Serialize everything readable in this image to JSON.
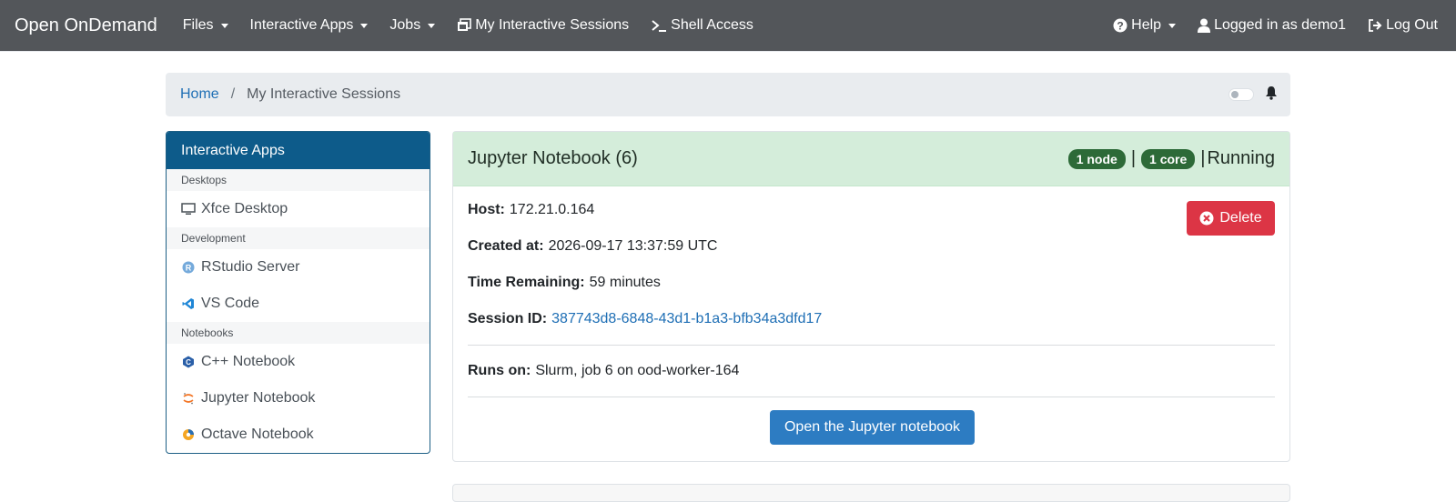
{
  "navbar": {
    "brand": "Open OnDemand",
    "items": [
      {
        "label": "Files"
      },
      {
        "label": "Interactive Apps"
      },
      {
        "label": "Jobs"
      },
      {
        "label": "My Interactive Sessions"
      },
      {
        "label": "Shell Access"
      }
    ],
    "help_label": "Help",
    "user_label": "Logged in as demo1",
    "logout_label": "Log Out"
  },
  "breadcrumb": {
    "home": "Home",
    "separator": "/",
    "current": "My Interactive Sessions"
  },
  "sidebar": {
    "title": "Interactive Apps",
    "categories": [
      {
        "name": "Desktops",
        "items": [
          {
            "label": "Xfce Desktop",
            "icon": "monitor-icon"
          }
        ]
      },
      {
        "name": "Development",
        "items": [
          {
            "label": "RStudio Server",
            "icon": "rstudio-icon"
          },
          {
            "label": "VS Code",
            "icon": "vscode-icon"
          }
        ]
      },
      {
        "name": "Notebooks",
        "items": [
          {
            "label": "C++ Notebook",
            "icon": "cpp-icon"
          },
          {
            "label": "Jupyter Notebook",
            "icon": "jupyter-icon"
          },
          {
            "label": "Octave Notebook",
            "icon": "octave-icon"
          }
        ]
      }
    ]
  },
  "session": {
    "title": "Jupyter Notebook (6)",
    "nodes_badge": "1 node",
    "cores_badge": "1 core",
    "pipe": "|",
    "status": "Running",
    "host_label": "Host:",
    "host": "172.21.0.164",
    "created_label": "Created at:",
    "created": "2026-09-17 13:37:59 UTC",
    "time_label": "Time Remaining:",
    "time_remaining": "59 minutes",
    "session_id_label": "Session ID:",
    "session_id": "387743d8-6848-43d1-b1a3-bfb34a3dfd17",
    "runs_on_label": "Runs on:",
    "runs_on": "Slurm, job 6 on ood-worker-164",
    "delete_label": "Delete",
    "open_label": "Open the Jupyter notebook"
  },
  "colors": {
    "navbar": "#53565a",
    "sidebar_header": "#0d5b8a",
    "card_header": "#d4edda",
    "badge": "#2d6a38",
    "delete": "#dc3545",
    "primary": "#2d7cc2",
    "link": "#1f6fb5"
  }
}
